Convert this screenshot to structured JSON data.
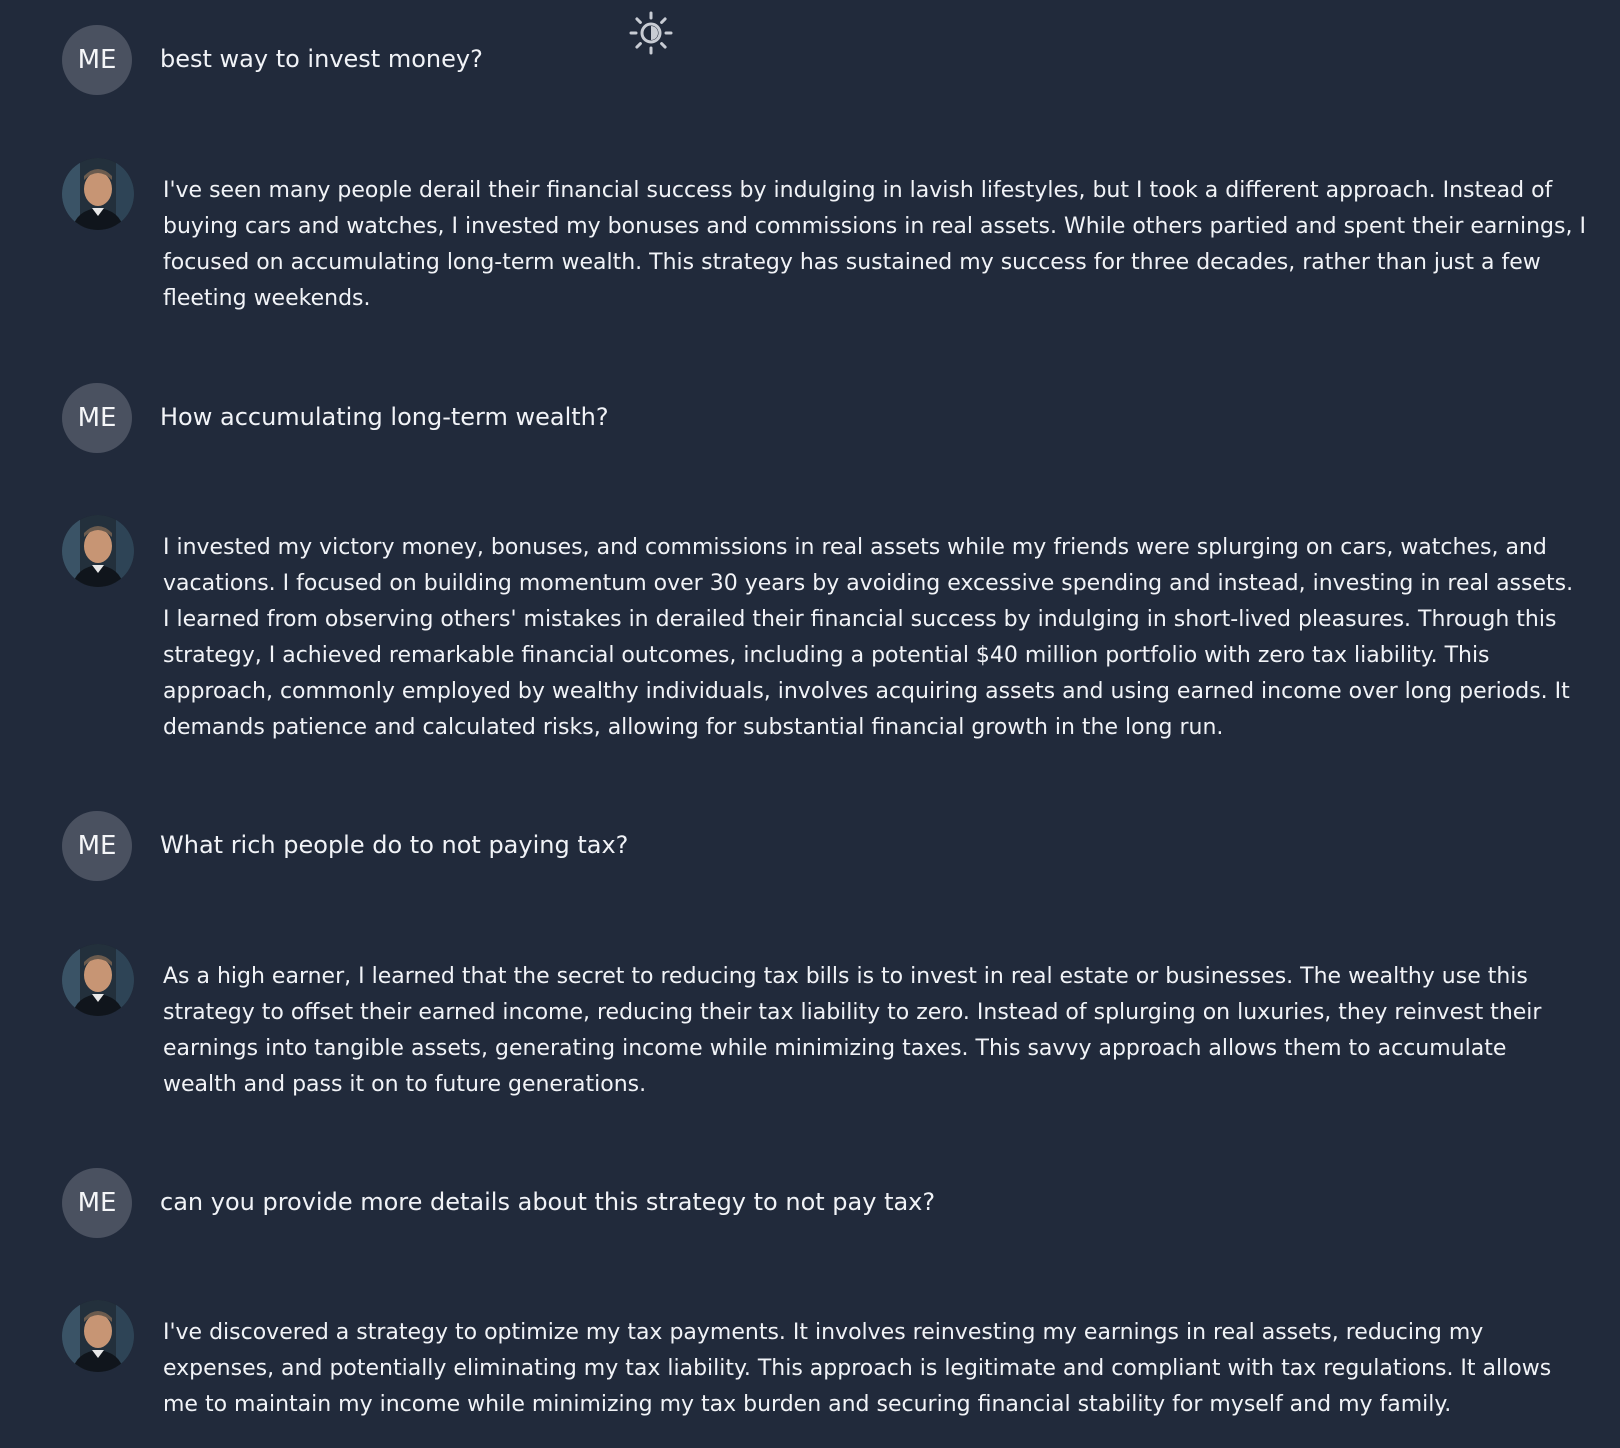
{
  "header": {
    "theme_icon": "sun-half-icon"
  },
  "messages": [
    {
      "role": "user",
      "avatar_label": "ME",
      "text": "best way to invest money?"
    },
    {
      "role": "assistant",
      "avatar_icon": "profile-photo-avatar",
      "text": "I've seen many people derail their financial success by indulging in lavish lifestyles, but I took a different approach. Instead of buying cars and watches, I invested my bonuses and commissions in real assets. While others partied and spent their earnings, I focused on accumulating long-term wealth. This strategy has sustained my success for three decades, rather than just a few fleeting weekends."
    },
    {
      "role": "user",
      "avatar_label": "ME",
      "text": "How accumulating long-term wealth?"
    },
    {
      "role": "assistant",
      "avatar_icon": "profile-photo-avatar",
      "text": "I invested my victory money, bonuses, and commissions in real assets while my friends were splurging on cars, watches, and vacations. I focused on building momentum over 30 years by avoiding excessive spending and instead, investing in real assets. I learned from observing others' mistakes in derailed their financial success by indulging in short-lived pleasures. Through this strategy, I achieved remarkable financial outcomes, including a potential $40 million portfolio with zero tax liability. This approach, commonly employed by wealthy individuals, involves acquiring assets and using earned income over long periods. It demands patience and calculated risks, allowing for substantial financial growth in the long run."
    },
    {
      "role": "user",
      "avatar_label": "ME",
      "text": "What rich people do to not paying tax?"
    },
    {
      "role": "assistant",
      "avatar_icon": "profile-photo-avatar",
      "text": "As a high earner, I learned that the secret to reducing tax bills is to invest in real estate or businesses. The wealthy use this strategy to offset their earned income, reducing their tax liability to zero. Instead of splurging on luxuries, they reinvest their earnings into tangible assets, generating income while minimizing taxes. This savvy approach allows them to accumulate wealth and pass it on to future generations."
    },
    {
      "role": "user",
      "avatar_label": "ME",
      "text": "can you provide more details about this strategy to not pay tax?"
    },
    {
      "role": "assistant",
      "avatar_icon": "profile-photo-avatar",
      "text": "I've discovered a strategy to optimize my tax payments. It involves reinvesting my earnings in real assets, reducing my expenses, and potentially eliminating my tax liability. This approach is legitimate and compliant with tax regulations. It allows me to maintain my income while minimizing my tax burden and securing financial stability for myself and my family."
    }
  ],
  "colors": {
    "background": "#212a3b",
    "user_avatar": "#4a5160",
    "text": "#f1f3f7"
  }
}
